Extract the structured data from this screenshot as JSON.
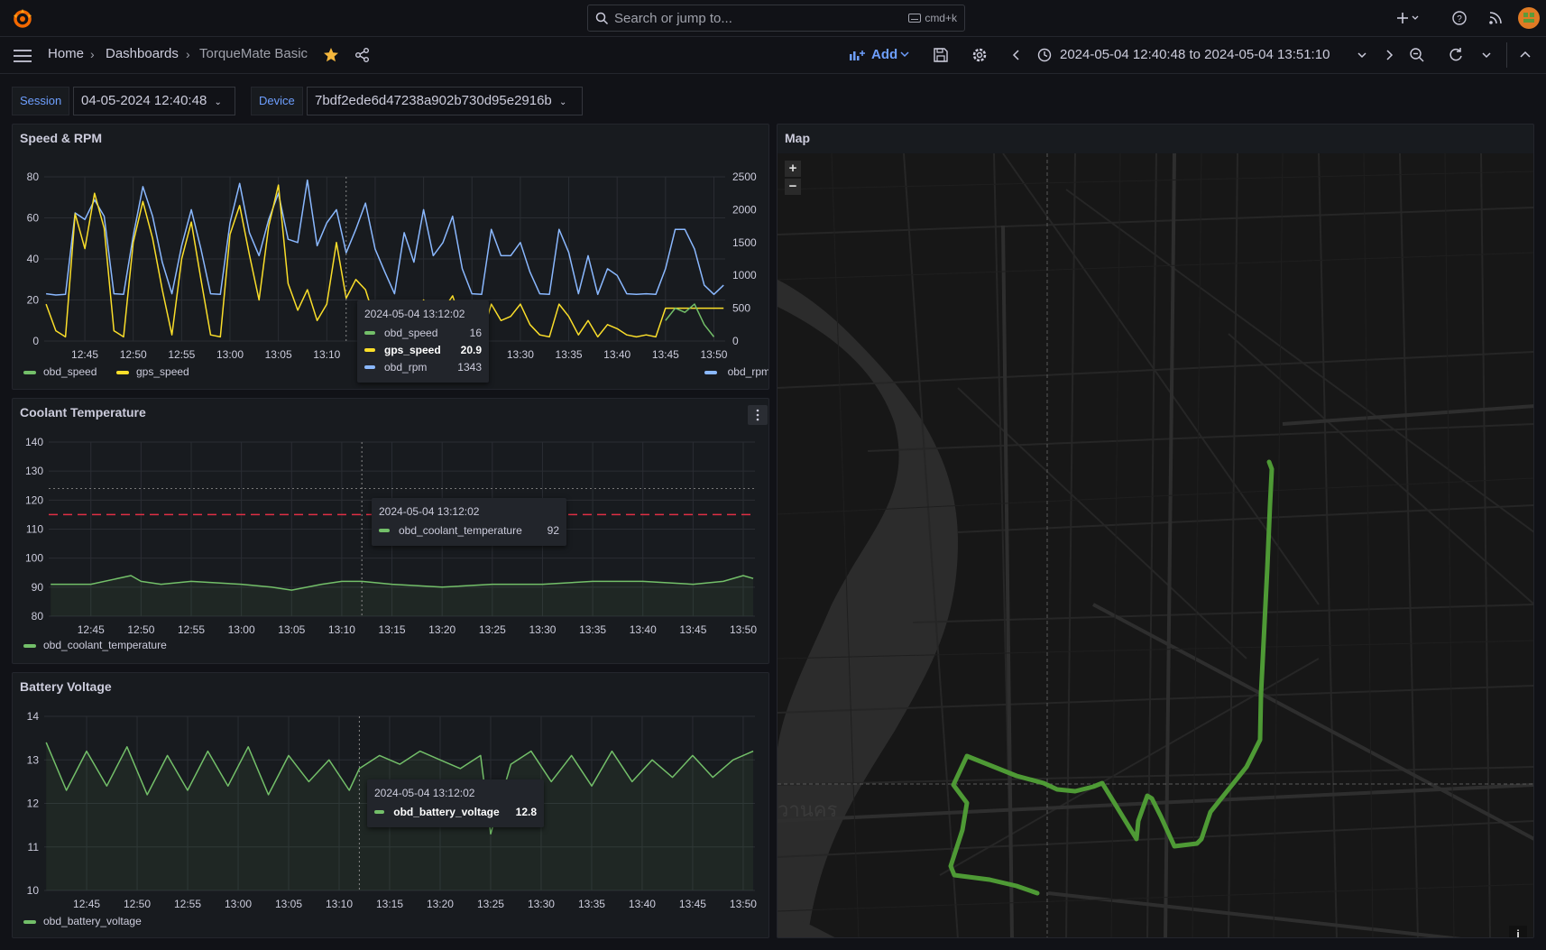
{
  "topbar": {
    "search_placeholder": "Search or jump to...",
    "search_shortcut": "cmd+k"
  },
  "nav": {
    "breadcrumb": [
      "Home",
      "Dashboards",
      "TorqueMate Basic"
    ],
    "add_label": "Add",
    "time_range": "2024-05-04 12:40:48 to 2024-05-04 13:51:10"
  },
  "variables": {
    "session_label": "Session",
    "session_value": "04-05-2024 12:40:48",
    "device_label": "Device",
    "device_value": "7bdf2ede6d47238a902b730d95e2916b"
  },
  "colors": {
    "obd_speed": "#73bf69",
    "gps_speed": "#fade2a",
    "obd_rpm": "#8ab8ff",
    "coolant": "#73bf69",
    "battery": "#73bf69",
    "threshold": "#e02f44",
    "route": "#4e9a35"
  },
  "panels": {
    "speed": {
      "title": "Speed & RPM",
      "tooltip": {
        "time": "2024-05-04 13:12:02",
        "rows": [
          {
            "name": "obd_speed",
            "value": "16",
            "bold": false,
            "color": "#73bf69"
          },
          {
            "name": "gps_speed",
            "value": "20.9",
            "bold": true,
            "color": "#fade2a"
          },
          {
            "name": "obd_rpm",
            "value": "1343",
            "bold": false,
            "color": "#8ab8ff"
          }
        ]
      }
    },
    "coolant": {
      "title": "Coolant Temperature",
      "tooltip": {
        "time": "2024-05-04 13:12:02",
        "rows": [
          {
            "name": "obd_coolant_temperature",
            "value": "92",
            "bold": false,
            "color": "#73bf69"
          }
        ]
      }
    },
    "battery": {
      "title": "Battery Voltage",
      "tooltip": {
        "time": "2024-05-04 13:12:02",
        "rows": [
          {
            "name": "obd_battery_voltage",
            "value": "12.8",
            "bold": true,
            "color": "#73bf69"
          }
        ]
      }
    },
    "map": {
      "title": "Map",
      "zoom_in": "+",
      "zoom_out": "−",
      "info": "i",
      "label_fragment": "วานคร"
    }
  },
  "chart_data": [
    {
      "type": "line",
      "title": "Speed & RPM",
      "x_ticks": [
        "12:45",
        "12:50",
        "12:55",
        "13:00",
        "13:05",
        "13:10",
        "13:15",
        "13:20",
        "13:25",
        "13:30",
        "13:35",
        "13:40",
        "13:45",
        "13:50"
      ],
      "xlim": [
        "12:40:48",
        "13:51:10"
      ],
      "ylim_left": [
        0,
        80
      ],
      "y_ticks_left": [
        0,
        20,
        40,
        60,
        80
      ],
      "ylim_right": [
        0,
        2500
      ],
      "y_ticks_right": [
        0,
        500,
        1000,
        1500,
        2000,
        2500
      ],
      "grid": true,
      "legend": "bottom",
      "legend_left": [
        "obd_speed",
        "gps_speed"
      ],
      "legend_right": [
        "obd_rpm"
      ],
      "series": [
        {
          "name": "obd_rpm",
          "axis": "right",
          "x": [
            "12:41",
            "12:42",
            "12:43",
            "12:44",
            "12:45",
            "12:46",
            "12:47",
            "12:48",
            "12:49",
            "12:50",
            "12:51",
            "12:52",
            "12:53",
            "12:54",
            "12:55",
            "12:56",
            "12:57",
            "12:58",
            "12:59",
            "13:00",
            "13:01",
            "13:02",
            "13:03",
            "13:04",
            "13:05",
            "13:06",
            "13:07",
            "13:08",
            "13:09",
            "13:10",
            "13:11",
            "13:12",
            "13:13",
            "13:14",
            "13:15",
            "13:16",
            "13:17",
            "13:18",
            "13:19",
            "13:20",
            "13:21",
            "13:22",
            "13:23",
            "13:24",
            "13:25",
            "13:26",
            "13:27",
            "13:28",
            "13:29",
            "13:30",
            "13:31",
            "13:32",
            "13:33",
            "13:34",
            "13:35",
            "13:36",
            "13:37",
            "13:38",
            "13:39",
            "13:40",
            "13:41",
            "13:42",
            "13:43",
            "13:44",
            "13:45",
            "13:46",
            "13:47",
            "13:48",
            "13:49",
            "13:50",
            "13:51"
          ],
          "values": [
            720,
            700,
            710,
            1950,
            1850,
            2150,
            1900,
            720,
            710,
            1600,
            2350,
            1900,
            1200,
            720,
            1450,
            2000,
            1400,
            720,
            710,
            1800,
            2400,
            1650,
            1300,
            1850,
            2250,
            1550,
            1500,
            2450,
            1450,
            1800,
            2000,
            1343,
            1700,
            2100,
            1400,
            1050,
            720,
            1650,
            1200,
            2000,
            1300,
            1500,
            1900,
            1100,
            720,
            710,
            1700,
            1300,
            1300,
            1500,
            1050,
            720,
            710,
            1700,
            1350,
            720,
            1300,
            710,
            1100,
            1000,
            720,
            710,
            720,
            710,
            1100,
            1700,
            1700,
            1400,
            850,
            710,
            850
          ]
        },
        {
          "name": "gps_speed",
          "axis": "left",
          "x": [
            "12:41",
            "12:42",
            "12:43",
            "12:44",
            "12:45",
            "12:46",
            "12:47",
            "12:48",
            "12:49",
            "12:50",
            "12:51",
            "12:52",
            "12:53",
            "12:54",
            "12:55",
            "12:56",
            "12:57",
            "12:58",
            "12:59",
            "13:00",
            "13:01",
            "13:02",
            "13:03",
            "13:04",
            "13:05",
            "13:06",
            "13:07",
            "13:08",
            "13:09",
            "13:10",
            "13:11",
            "13:12",
            "13:13",
            "13:14",
            "13:15",
            "13:16",
            "13:17",
            "13:18",
            "13:19",
            "13:20",
            "13:21",
            "13:22",
            "13:23",
            "13:24",
            "13:25",
            "13:26",
            "13:27",
            "13:28",
            "13:29",
            "13:30",
            "13:31",
            "13:32",
            "13:33",
            "13:34",
            "13:35",
            "13:36",
            "13:37",
            "13:38",
            "13:39",
            "13:40",
            "13:41",
            "13:42",
            "13:43",
            "13:44",
            "13:45",
            "13:46",
            "13:47",
            "13:48",
            "13:49",
            "13:50",
            "13:51"
          ],
          "values": [
            18,
            5,
            2,
            62,
            45,
            72,
            55,
            5,
            2,
            48,
            68,
            50,
            25,
            3,
            40,
            58,
            30,
            3,
            2,
            52,
            66,
            42,
            20,
            56,
            76,
            28,
            15,
            25,
            10,
            18,
            48,
            20.9,
            30,
            25,
            10,
            8,
            3,
            15,
            5,
            20,
            10,
            15,
            22,
            8,
            3,
            2,
            18,
            10,
            12,
            18,
            8,
            3,
            2,
            18,
            12,
            3,
            10,
            2,
            8,
            6,
            3,
            2,
            3,
            2,
            16,
            16,
            16,
            16,
            16,
            16,
            16
          ]
        },
        {
          "name": "obd_speed",
          "axis": "left",
          "x": [
            "13:45",
            "13:46",
            "13:47",
            "13:48",
            "13:49",
            "13:50"
          ],
          "values": [
            10,
            16,
            14,
            18,
            8,
            2
          ]
        }
      ]
    },
    {
      "type": "line",
      "title": "Coolant Temperature",
      "x_ticks": [
        "12:45",
        "12:50",
        "12:55",
        "13:00",
        "13:05",
        "13:10",
        "13:15",
        "13:20",
        "13:25",
        "13:30",
        "13:35",
        "13:40",
        "13:45",
        "13:50"
      ],
      "xlim": [
        "12:40:48",
        "13:51:10"
      ],
      "ylim": [
        80,
        140
      ],
      "y_ticks": [
        80,
        90,
        100,
        110,
        120,
        130,
        140
      ],
      "thresholds": [
        115,
        124
      ],
      "grid": true,
      "legend": "bottom",
      "series": [
        {
          "name": "obd_coolant_temperature",
          "x": [
            "12:41",
            "12:45",
            "12:49",
            "12:50",
            "12:52",
            "12:55",
            "13:00",
            "13:03",
            "13:05",
            "13:08",
            "13:10",
            "13:12",
            "13:15",
            "13:20",
            "13:25",
            "13:30",
            "13:35",
            "13:40",
            "13:45",
            "13:48",
            "13:50",
            "13:51"
          ],
          "values": [
            91,
            91,
            94,
            92,
            91,
            92,
            91,
            90,
            89,
            91,
            92,
            92,
            91,
            90,
            91,
            91,
            92,
            92,
            91,
            92,
            94,
            93
          ]
        }
      ]
    },
    {
      "type": "line",
      "title": "Battery Voltage",
      "x_ticks": [
        "12:45",
        "12:50",
        "12:55",
        "13:00",
        "13:05",
        "13:10",
        "13:15",
        "13:20",
        "13:25",
        "13:30",
        "13:35",
        "13:40",
        "13:45",
        "13:50"
      ],
      "xlim": [
        "12:40:48",
        "13:51:10"
      ],
      "ylim": [
        10,
        14
      ],
      "y_ticks": [
        10,
        11,
        12,
        13,
        14
      ],
      "grid": true,
      "legend": "bottom",
      "series": [
        {
          "name": "obd_battery_voltage",
          "x": [
            "12:41",
            "12:43",
            "12:45",
            "12:47",
            "12:49",
            "12:51",
            "12:53",
            "12:55",
            "12:57",
            "12:59",
            "13:01",
            "13:03",
            "13:05",
            "13:07",
            "13:09",
            "13:11",
            "13:12",
            "13:14",
            "13:16",
            "13:18",
            "13:20",
            "13:22",
            "13:24",
            "13:25",
            "13:27",
            "13:29",
            "13:31",
            "13:33",
            "13:35",
            "13:37",
            "13:39",
            "13:41",
            "13:43",
            "13:45",
            "13:47",
            "13:49",
            "13:51"
          ],
          "values": [
            13.4,
            12.3,
            13.2,
            12.4,
            13.3,
            12.2,
            13.1,
            12.3,
            13.2,
            12.4,
            13.3,
            12.2,
            13.1,
            12.5,
            13.0,
            12.3,
            12.8,
            13.1,
            12.9,
            13.2,
            13.0,
            12.8,
            13.1,
            11.3,
            12.9,
            13.2,
            12.5,
            13.1,
            12.4,
            13.2,
            12.5,
            13.0,
            12.6,
            13.1,
            12.6,
            13.0,
            13.2
          ]
        }
      ]
    }
  ]
}
